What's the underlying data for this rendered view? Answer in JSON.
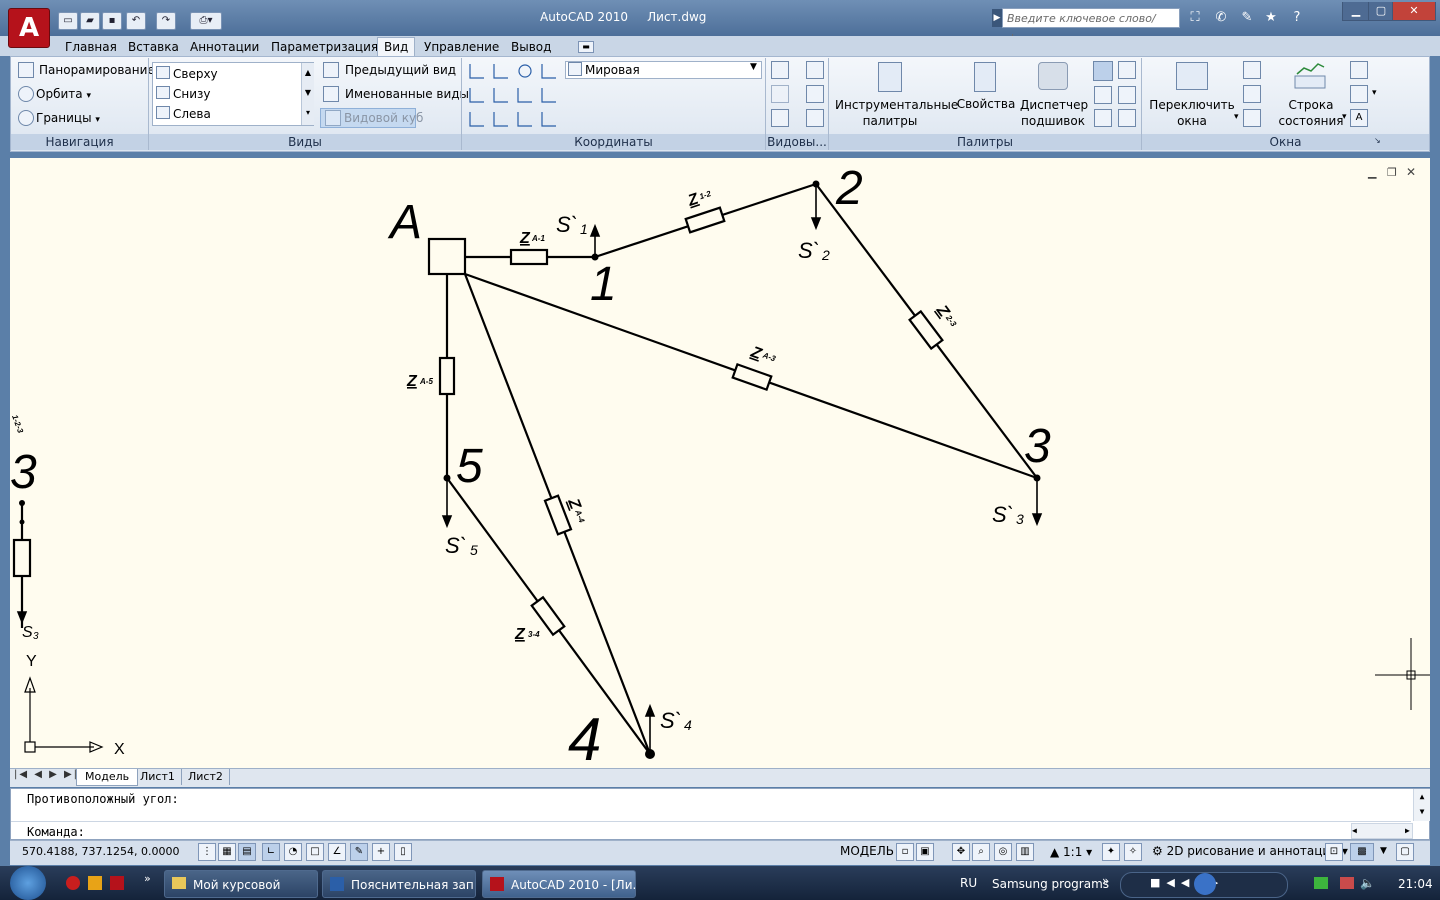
{
  "titlebar": {
    "app_logo": "A",
    "app_name": "AutoCAD 2010",
    "file_name": "Лист.dwg",
    "search_placeholder": "Введите ключевое слово/фразу"
  },
  "ribbon_tabs": [
    "Главная",
    "Вставка",
    "Аннотации",
    "Параметризация",
    "Вид",
    "Управление",
    "Вывод"
  ],
  "active_tab": "Вид",
  "navigation": {
    "pan": "Панорамирование",
    "orbit": "Орбита",
    "extents": "Границы",
    "label": "Навигация"
  },
  "views": {
    "list": [
      "Сверху",
      "Снизу",
      "Слева"
    ],
    "previous_view": "Предыдущий вид",
    "named_views": "Именованные виды",
    "view_cube": "Видовой куб",
    "label": "Виды"
  },
  "coordinates": {
    "ucs_value": "Мировая",
    "label": "Координаты"
  },
  "viewports": {
    "label": "Видовы..."
  },
  "palettes": {
    "tool_palettes_line1": "Инструментальные",
    "tool_palettes_line2": "палитры",
    "properties": "Свойства",
    "sheet_manager_line1": "Диспетчер",
    "sheet_manager_line2": "подшивок",
    "label": "Палитры"
  },
  "windows": {
    "switch_line1": "Переключить",
    "switch_line2": "окна",
    "status_bar_line1": "Строка",
    "status_bar_line2": "состояния",
    "label": "Окна"
  },
  "drawing": {
    "node_labels": {
      "A": "A",
      "n1": "1",
      "n2": "2",
      "n3": "3",
      "n4": "4",
      "n5": "5",
      "n3_left": "3"
    },
    "impedances": {
      "zA1": "Z",
      "zA1_sub": "A-1",
      "z12": "Z",
      "z12_sub": "1-2",
      "z23": "Z",
      "z23_sub": "2-3",
      "zA3": "Z",
      "zA3_sub": "A-3",
      "zA5": "Z",
      "zA5_sub": "A-5",
      "zA4": "Z",
      "zA4_sub": "A-4",
      "z34": "Z",
      "z34_sub": "3-4"
    },
    "loads": {
      "s1": "S`",
      "s1_sub": "1",
      "s2": "S`",
      "s2_sub": "2",
      "s3": "S`",
      "s3_sub": "3",
      "s4": "S`",
      "s4_sub": "4",
      "s5": "S`",
      "s5_sub": "5",
      "s3_left": "S",
      "s3_left_sub": "3"
    },
    "edge_fragment": "1-2-3",
    "ucs_x": "X",
    "ucs_y": "Y"
  },
  "layout_tabs": [
    "Модель",
    "Лист1",
    "Лист2"
  ],
  "command": {
    "history_line": "Противоположный угол:",
    "prompt": "Команда:"
  },
  "status": {
    "coords": "570.4188, 737.1254, 0.0000",
    "model": "МОДЕЛЬ",
    "scale": "1:1",
    "workspace": "2D рисование и аннотации"
  },
  "taskbar": {
    "items": [
      "Мой курсовой",
      "Пояснительная зап...",
      "AutoCAD 2010 - [Ли..."
    ],
    "lang": "RU",
    "toolbar_name": "Samsung programs",
    "clock": "21:04"
  },
  "colors": {
    "canvas": "#fffcef",
    "ribbon": "#dce5f0",
    "titlebar": "#4d6f99",
    "logo": "#b5121b"
  }
}
